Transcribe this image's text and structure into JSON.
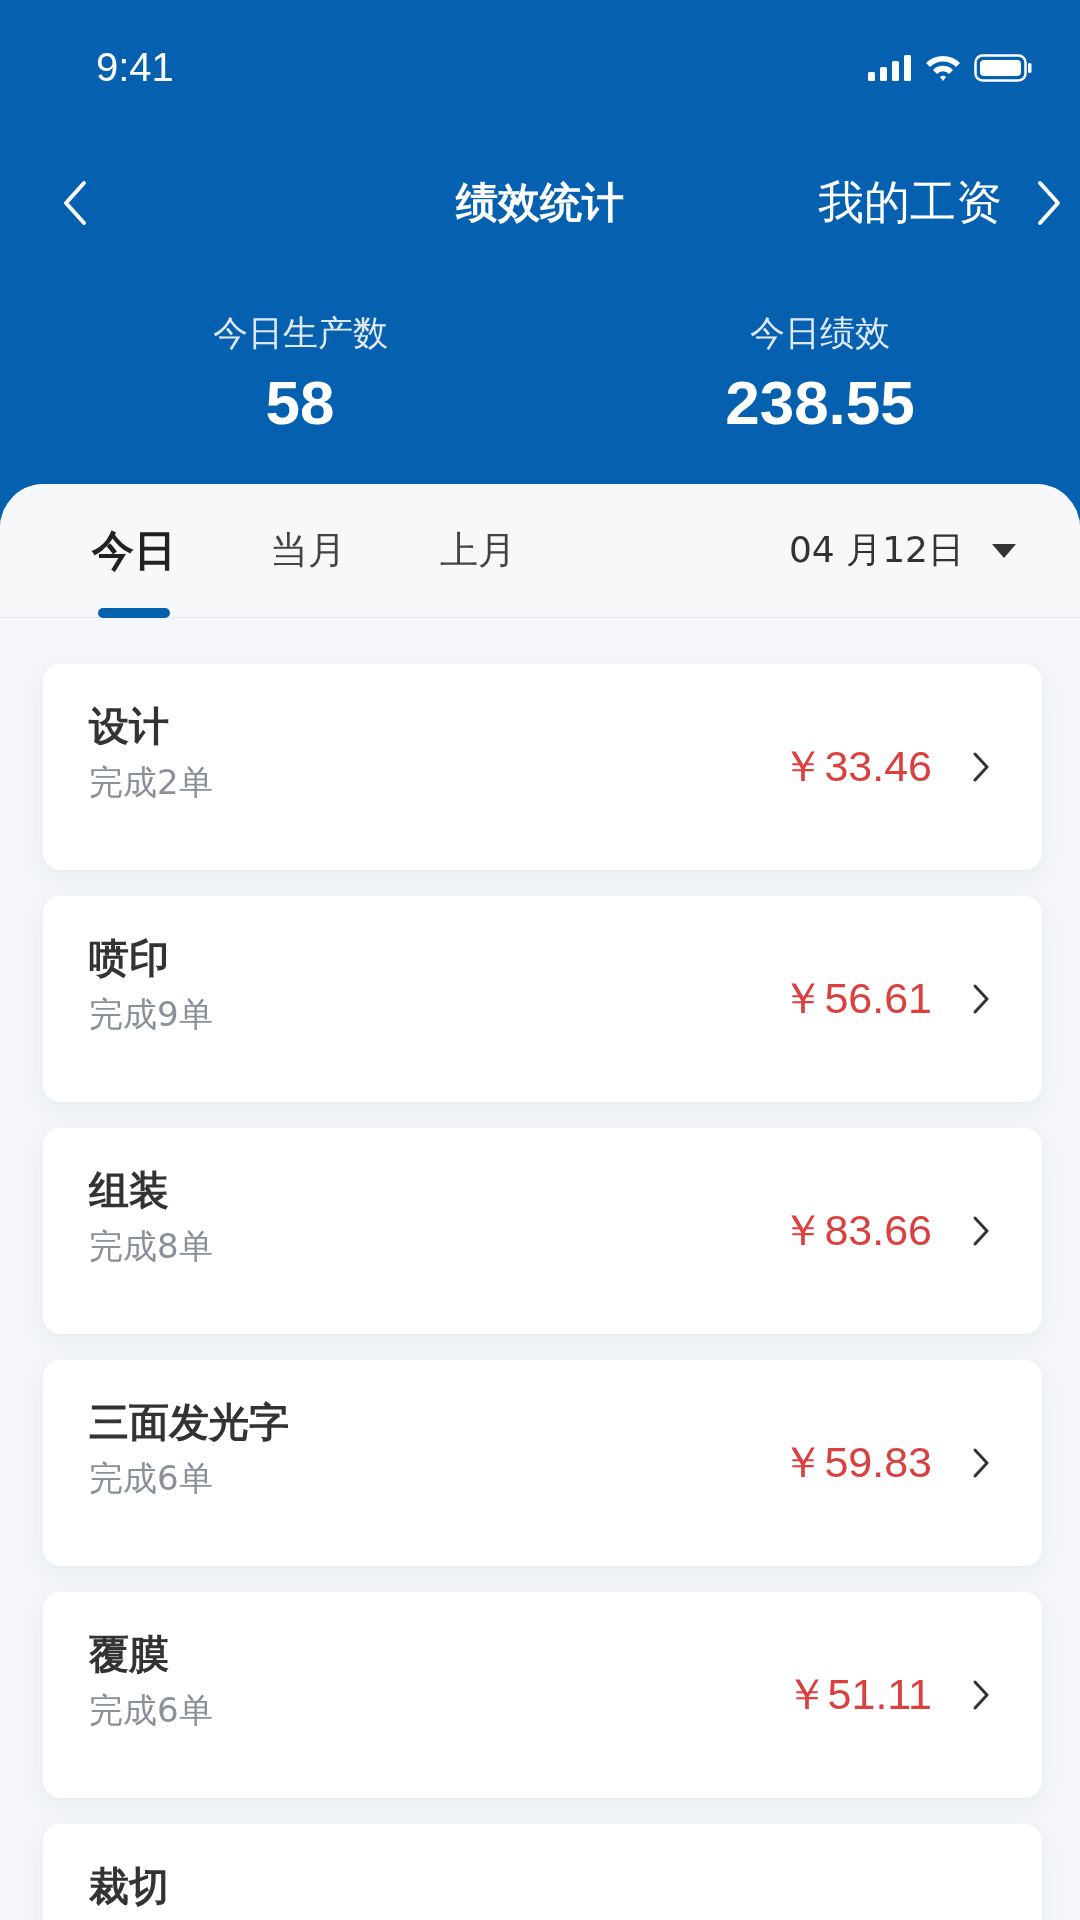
{
  "status_bar": {
    "time": "9:41"
  },
  "nav": {
    "title": "绩效统计",
    "right_link": "我的工资"
  },
  "stats": [
    {
      "label": "今日生产数",
      "value": "58"
    },
    {
      "label": "今日绩效",
      "value": "238.55"
    }
  ],
  "tabs": [
    {
      "label": "今日",
      "selected": true
    },
    {
      "label": "当月",
      "selected": false
    },
    {
      "label": "上月",
      "selected": false
    }
  ],
  "date_picker": {
    "value": "04 月12日"
  },
  "items": [
    {
      "name": "设计",
      "detail": "完成2单",
      "amount": "￥33.46"
    },
    {
      "name": "喷印",
      "detail": "完成9单",
      "amount": "￥56.61"
    },
    {
      "name": "组装",
      "detail": "完成8单",
      "amount": "￥83.66"
    },
    {
      "name": "三面发光字",
      "detail": "完成6单",
      "amount": "￥59.83"
    },
    {
      "name": "覆膜",
      "detail": "完成6单",
      "amount": "￥51.11"
    },
    {
      "name": "裁切"
    }
  ]
}
